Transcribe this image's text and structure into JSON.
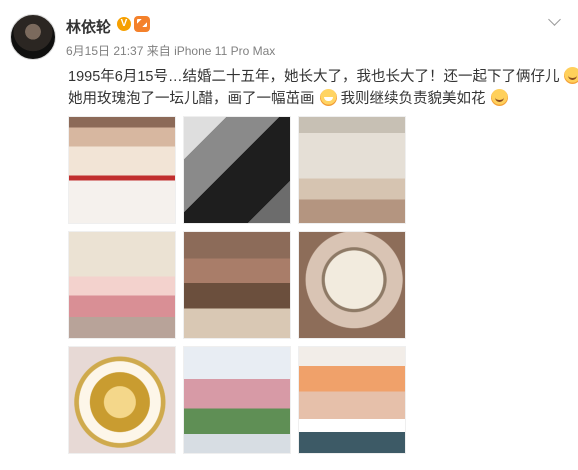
{
  "user": {
    "name": "林依轮",
    "badge": "V",
    "vip_icon": "vip-icon"
  },
  "post": {
    "date": "6月15日",
    "time": "21:37",
    "source": "来自 iPhone 11 Pro Max",
    "text_line_1": "1995年6月15号…结婚二十五年，她长大了，我也长大了！还一起下了俩仔儿",
    "text_line_2a": "她用玫瑰泡了一坛儿醋，画了一幅茁画",
    "text_line_2b": "我则继续负责貌美如花",
    "emoji_1": "grin-emoji",
    "emoji_2": "laugh-emoji",
    "emoji_3": "grin-emoji"
  },
  "actions": {
    "menu_icon": "chevron-down-icon"
  },
  "images": [
    "wedding-photo",
    "portrait-photo",
    "glassware-photo",
    "woman-photo",
    "group-photo",
    "painting-photo",
    "watch-photo",
    "flowers-photo",
    "family-photo"
  ],
  "colors": {
    "vip": "#f4812b",
    "verified": "#f6a000",
    "meta": "#808080"
  }
}
